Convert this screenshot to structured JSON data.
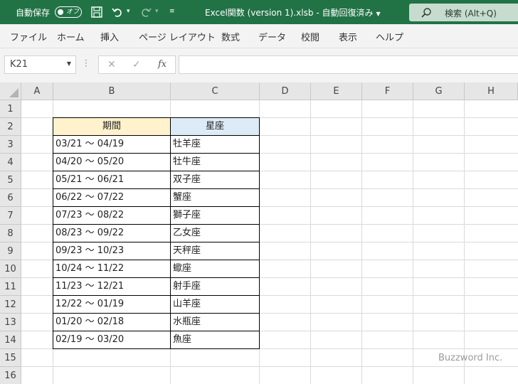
{
  "titlebar": {
    "autosave_label": "自動保存",
    "toggle_label": "オフ",
    "document_title": "Excel関数 (version 1).xlsb",
    "save_status": "自動回復済み",
    "search_placeholder": "検索 (Alt+Q)",
    "colors": {
      "accent": "#217346",
      "search_bg": "#c7dccf"
    }
  },
  "menu": {
    "items": [
      "ファイル",
      "ホーム",
      "挿入",
      "ページ レイアウト",
      "数式",
      "データ",
      "校閲",
      "表示",
      "ヘルプ"
    ]
  },
  "formula_bar": {
    "name_box": "K21",
    "cancel_icon": "✕",
    "enter_icon": "✓",
    "fx_label": "fx",
    "content": ""
  },
  "grid": {
    "columns": [
      "A",
      "B",
      "C",
      "D",
      "E",
      "F",
      "G",
      "H"
    ],
    "rows": [
      "1",
      "2",
      "3",
      "4",
      "5",
      "6",
      "7",
      "8",
      "9",
      "10",
      "11",
      "12",
      "13",
      "14",
      "15",
      "16"
    ]
  },
  "table": {
    "headers": {
      "period": "期間",
      "constellation": "星座"
    },
    "header_colors": {
      "period": "#fff2cc",
      "constellation": "#ddebf7"
    },
    "rows": [
      {
        "period": "03/21 ～ 04/19",
        "sign": "牡羊座"
      },
      {
        "period": "04/20 ～ 05/20",
        "sign": "牡牛座"
      },
      {
        "period": "05/21 ～ 06/21",
        "sign": "双子座"
      },
      {
        "period": "06/22 ～ 07/22",
        "sign": "蟹座"
      },
      {
        "period": "07/23 ～ 08/22",
        "sign": "獅子座"
      },
      {
        "period": "08/23 ～ 09/22",
        "sign": "乙女座"
      },
      {
        "period": "09/23 ～ 10/23",
        "sign": "天秤座"
      },
      {
        "period": "10/24 ～ 11/22",
        "sign": "蠍座"
      },
      {
        "period": "11/23 ～ 12/21",
        "sign": "射手座"
      },
      {
        "period": "12/22 ～ 01/19",
        "sign": "山羊座"
      },
      {
        "period": "01/20 ～ 02/18",
        "sign": "水瓶座"
      },
      {
        "period": "02/19 ～ 03/20",
        "sign": "魚座"
      }
    ]
  },
  "watermark": "Buzzword Inc."
}
